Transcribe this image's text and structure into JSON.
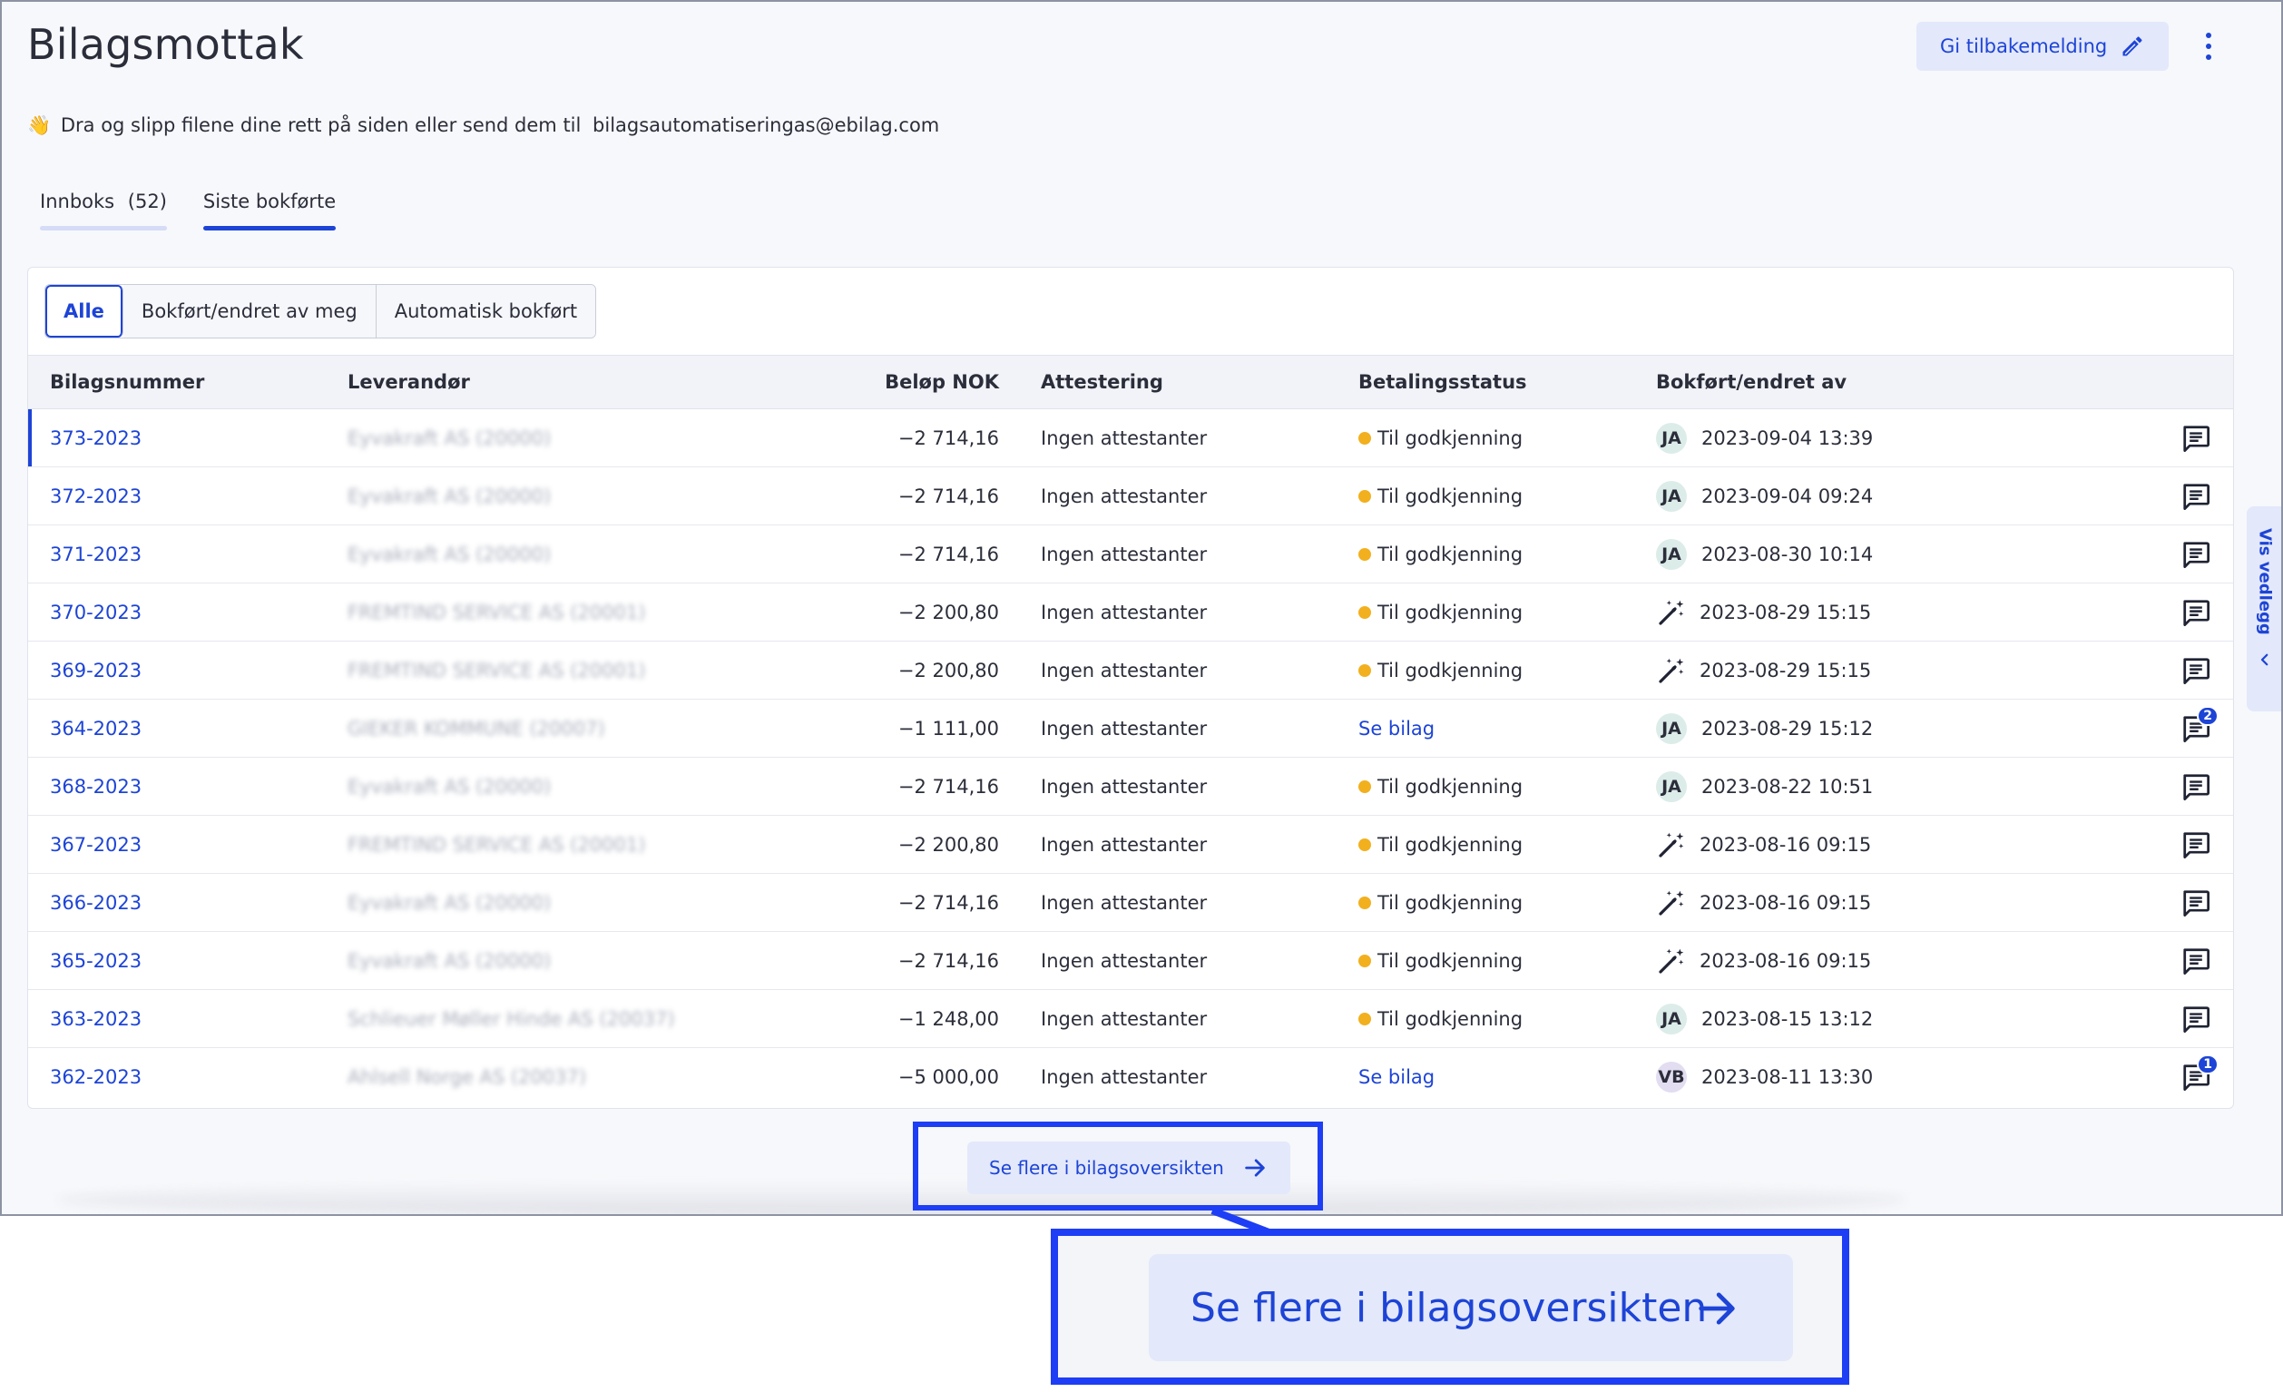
{
  "header": {
    "title": "Bilagsmottak",
    "feedback_label": "Gi tilbakemelding",
    "drop_text": "Dra og slipp filene dine rett på siden eller send dem til",
    "email": "bilagsautomatiseringas@ebilag.com",
    "wave_emoji": "👋"
  },
  "tabs": [
    {
      "label": "Innboks",
      "count": "(52)",
      "active": false
    },
    {
      "label": "Siste bokførte",
      "active": true
    }
  ],
  "filters": [
    "Alle",
    "Bokført/endret av meg",
    "Automatisk bokført"
  ],
  "table": {
    "columns": [
      "Bilagsnummer",
      "Leverandør",
      "Beløp NOK",
      "Attestering",
      "Betalingsstatus",
      "Bokført/endret av"
    ],
    "rows": [
      {
        "num": "373-2023",
        "supplier": "Eyvakraft AS (20000)",
        "amount": "−2 714,16",
        "attest": "Ingen attestanter",
        "status": "Til godkjenning",
        "status_type": "pending",
        "by": "JA",
        "by_type": "user",
        "date": "2023-09-04 13:39",
        "comments": ""
      },
      {
        "num": "372-2023",
        "supplier": "Eyvakraft AS (20000)",
        "amount": "−2 714,16",
        "attest": "Ingen attestanter",
        "status": "Til godkjenning",
        "status_type": "pending",
        "by": "JA",
        "by_type": "user",
        "date": "2023-09-04 09:24",
        "comments": ""
      },
      {
        "num": "371-2023",
        "supplier": "Eyvakraft AS (20000)",
        "amount": "−2 714,16",
        "attest": "Ingen attestanter",
        "status": "Til godkjenning",
        "status_type": "pending",
        "by": "JA",
        "by_type": "user",
        "date": "2023-08-30 10:14",
        "comments": ""
      },
      {
        "num": "370-2023",
        "supplier": "FREMTIND SERVICE AS (20001)",
        "amount": "−2 200,80",
        "attest": "Ingen attestanter",
        "status": "Til godkjenning",
        "status_type": "pending",
        "by": "",
        "by_type": "auto",
        "date": "2023-08-29 15:15",
        "comments": ""
      },
      {
        "num": "369-2023",
        "supplier": "FREMTIND SERVICE AS (20001)",
        "amount": "−2 200,80",
        "attest": "Ingen attestanter",
        "status": "Til godkjenning",
        "status_type": "pending",
        "by": "",
        "by_type": "auto",
        "date": "2023-08-29 15:15",
        "comments": ""
      },
      {
        "num": "364-2023",
        "supplier": "GIEKER KOMMUNE (20007)",
        "amount": "−1 111,00",
        "attest": "Ingen attestanter",
        "status": "Se bilag",
        "status_type": "link",
        "by": "JA",
        "by_type": "user",
        "date": "2023-08-29 15:12",
        "comments": "2"
      },
      {
        "num": "368-2023",
        "supplier": "Eyvakraft AS (20000)",
        "amount": "−2 714,16",
        "attest": "Ingen attestanter",
        "status": "Til godkjenning",
        "status_type": "pending",
        "by": "JA",
        "by_type": "user",
        "date": "2023-08-22 10:51",
        "comments": ""
      },
      {
        "num": "367-2023",
        "supplier": "FREMTIND SERVICE AS (20001)",
        "amount": "−2 200,80",
        "attest": "Ingen attestanter",
        "status": "Til godkjenning",
        "status_type": "pending",
        "by": "",
        "by_type": "auto",
        "date": "2023-08-16 09:15",
        "comments": ""
      },
      {
        "num": "366-2023",
        "supplier": "Eyvakraft AS (20000)",
        "amount": "−2 714,16",
        "attest": "Ingen attestanter",
        "status": "Til godkjenning",
        "status_type": "pending",
        "by": "",
        "by_type": "auto",
        "date": "2023-08-16 09:15",
        "comments": ""
      },
      {
        "num": "365-2023",
        "supplier": "Eyvakraft AS (20000)",
        "amount": "−2 714,16",
        "attest": "Ingen attestanter",
        "status": "Til godkjenning",
        "status_type": "pending",
        "by": "",
        "by_type": "auto",
        "date": "2023-08-16 09:15",
        "comments": ""
      },
      {
        "num": "363-2023",
        "supplier": "Schlieuer Møller Hinde AS (20037)",
        "amount": "−1 248,00",
        "attest": "Ingen attestanter",
        "status": "Til godkjenning",
        "status_type": "pending",
        "by": "JA",
        "by_type": "user",
        "date": "2023-08-15 13:12",
        "comments": ""
      },
      {
        "num": "362-2023",
        "supplier": "Ahlsell Norge AS (20037)",
        "amount": "−5 000,00",
        "attest": "Ingen attestanter",
        "status": "Se bilag",
        "status_type": "link",
        "by": "VB",
        "by_type": "user",
        "date": "2023-08-11 13:30",
        "comments": "1"
      }
    ]
  },
  "more_button_label": "Se flere i bilagsoversikten",
  "side_tab_label": "Vis vedlegg",
  "colors": {
    "accent": "#1d44d6",
    "pending_dot": "#f2b01e",
    "highlight": "#1d3ef5"
  }
}
